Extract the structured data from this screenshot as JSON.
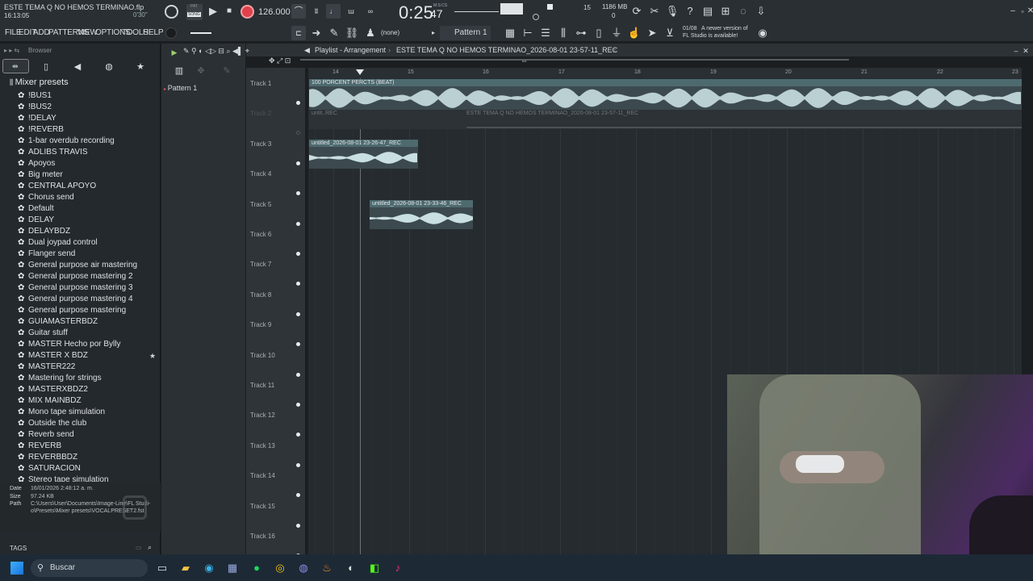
{
  "window": {
    "file_title": "ESTE TEMA Q NO HEMOS TERMINAO.flp",
    "clock": "16:13:05",
    "song_pos_small": "0'30\"",
    "song_label": "SONG",
    "pat_label": "PAT"
  },
  "transport": {
    "bpm": "126.000",
    "time": "0:25",
    "time_sub": "47",
    "time_unit": "M:S:CS",
    "cpu": "15",
    "memory": "1186 MB",
    "voices": "0"
  },
  "menu": [
    "FILE",
    "EDIT",
    "ADD",
    "PATTERNS",
    "VIEW",
    "OPTIONS",
    "TOOLS",
    "HELP"
  ],
  "toolbar": {
    "none_label": "(none)",
    "pattern": "Pattern 1",
    "update_date": "01/08",
    "update_text_1": "A newer version of",
    "update_text_2": "FL Studio is available!"
  },
  "browser": {
    "title": "Browser",
    "folder": "Mixer presets",
    "items": [
      "!BUS1",
      "!BUS2",
      "!DELAY",
      "!REVERB",
      "1-bar overdub recording",
      "ADLIBS TRAVIS",
      "Apoyos",
      "Big meter",
      "CENTRAL APOYO",
      "Chorus send",
      "Default",
      "DELAY",
      "DELAYBDZ",
      "Dual joypad control",
      "Flanger send",
      "General purpose air mastering",
      "General purpose mastering 2",
      "General purpose mastering 3",
      "General purpose mastering 4",
      "General purpose mastering",
      "GUIAMASTERBDZ",
      "Guitar stuff",
      "MASTER Hecho por Bylly",
      "MASTER X BDZ",
      "MASTER222",
      "Mastering for strings",
      "MASTERXBDZ2",
      "MIX MAINBDZ",
      "Mono tape simulation",
      "Outside the club",
      "Reverb send",
      "REVERB",
      "REVERBBDZ",
      "SATURACION",
      "Stereo tape simulation"
    ],
    "info": {
      "date_label": "Date",
      "date": "16/01/2026 2:48:12 a. m.",
      "size_label": "Size",
      "size": "97.24 KB",
      "path_label": "Path",
      "path_1": "C:\\Users\\User\\Documents\\Image-Line\\FL Studi-",
      "path_2": "o\\Presets\\Mixer presets\\VOCALPRESET2.fst"
    },
    "tags": "TAGS"
  },
  "patterns": {
    "item": "Pattern 1"
  },
  "playlist": {
    "title": "Playlist - Arrangement",
    "song": "ESTE TEMA Q NO HEMOS TERMINAO_2026-08-01 23-57-11_REC",
    "bars": [
      "14",
      "15",
      "16",
      "17",
      "18",
      "19",
      "20",
      "21",
      "22",
      "23"
    ],
    "tracks": [
      "Track 1",
      "Track 2",
      "Track 3",
      "Track 4",
      "Track 5",
      "Track 6",
      "Track 7",
      "Track 8",
      "Track 9",
      "Track 10",
      "Track 11",
      "Track 12",
      "Track 13",
      "Track 14",
      "Track 15",
      "Track 16"
    ],
    "clips": {
      "c1": "100 PORCENT PERCTS (BEAT)",
      "c2a": "untit..REC",
      "c2b": "ESTE TEMA Q NO HEMOS TERMINAO_2026-08-01 23-57-11_REC",
      "c3": "untitled_2026-08-01 23-26-47_REC",
      "c5": "untitled_2026-08-01 23-33-46_REC"
    }
  },
  "taskbar": {
    "search": "Buscar"
  }
}
